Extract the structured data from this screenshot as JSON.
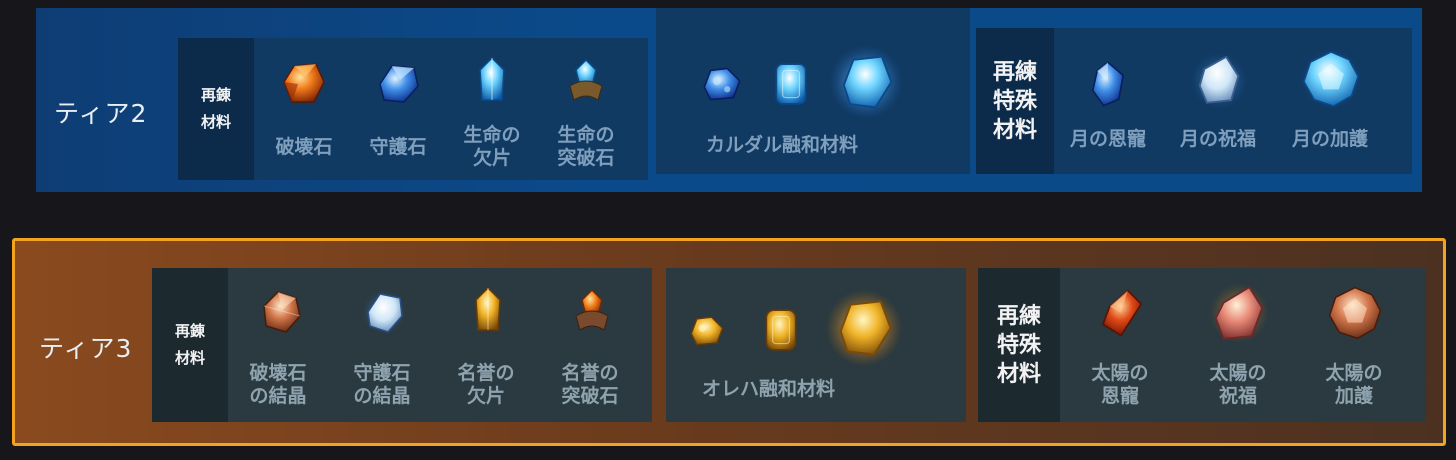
{
  "tiers": [
    {
      "title": "ティア2",
      "refine_materials": {
        "category": [
          "再錬",
          "材料"
        ],
        "items": [
          {
            "line1": "破壊石",
            "line2": "",
            "icon": "destruction-stone-icon"
          },
          {
            "line1": "守護石",
            "line2": "",
            "icon": "guardian-stone-icon"
          },
          {
            "line1": "生命の",
            "line2": "欠片",
            "icon": "life-shard-icon"
          },
          {
            "line1": "生命の",
            "line2": "突破石",
            "icon": "life-leapstone-icon"
          }
        ]
      },
      "fusion": {
        "label": "カルダル融和材料",
        "icons": [
          "ore-small-icon",
          "ore-medium-icon",
          "ore-large-icon"
        ]
      },
      "special_materials": {
        "category": [
          "再練",
          "特殊",
          "材料"
        ],
        "items": [
          {
            "line1": "月の恩寵",
            "line2": "",
            "icon": "moon-grace-icon"
          },
          {
            "line1": "月の祝福",
            "line2": "",
            "icon": "moon-blessing-icon"
          },
          {
            "line1": "月の加護",
            "line2": "",
            "icon": "moon-protection-icon"
          }
        ]
      },
      "colors": {
        "accent": "#0b4a8a"
      }
    },
    {
      "title": "ティア3",
      "refine_materials": {
        "category": [
          "再錬",
          "材料"
        ],
        "items": [
          {
            "line1": "破壊石",
            "line2": "の結晶",
            "icon": "destruction-crystal-icon"
          },
          {
            "line1": "守護石",
            "line2": "の結晶",
            "icon": "guardian-crystal-icon"
          },
          {
            "line1": "名誉の",
            "line2": "欠片",
            "icon": "honor-shard-icon"
          },
          {
            "line1": "名誉の",
            "line2": "突破石",
            "icon": "honor-leapstone-icon"
          }
        ]
      },
      "fusion": {
        "label": "オレハ融和材料",
        "icons": [
          "ore-small-icon",
          "ore-medium-icon",
          "ore-large-icon"
        ]
      },
      "special_materials": {
        "category": [
          "再練",
          "特殊",
          "材料"
        ],
        "items": [
          {
            "line1": "太陽の",
            "line2": "恩寵",
            "icon": "sun-grace-icon"
          },
          {
            "line1": "太陽の",
            "line2": "祝福",
            "icon": "sun-blessing-icon"
          },
          {
            "line1": "太陽の",
            "line2": "加護",
            "icon": "sun-protection-icon"
          }
        ]
      },
      "colors": {
        "accent": "#f3a31f"
      }
    }
  ]
}
